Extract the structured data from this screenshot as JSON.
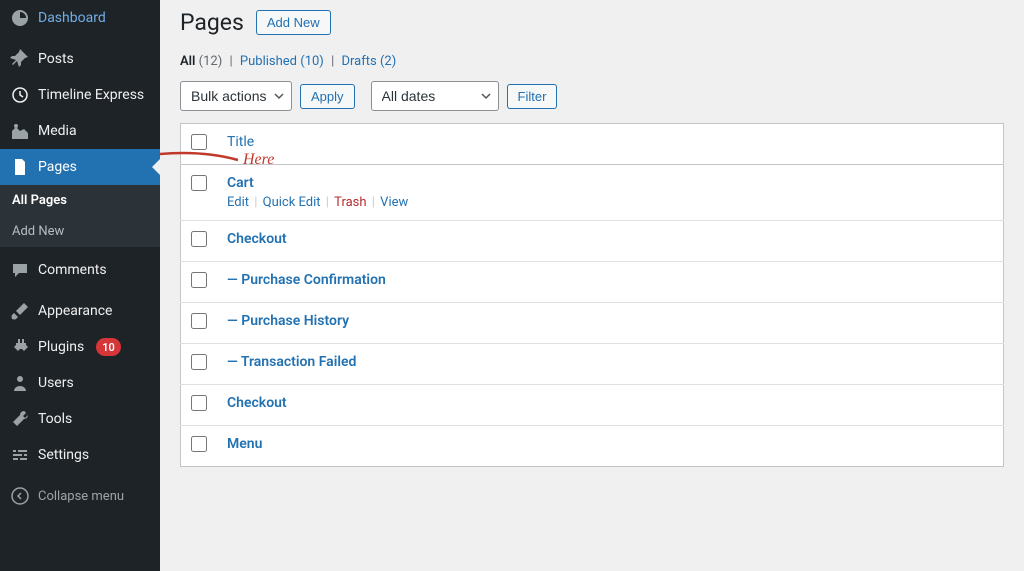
{
  "sidebar": {
    "items": [
      {
        "label": "Dashboard",
        "icon": "dashboard"
      },
      {
        "label": "Posts",
        "icon": "pin"
      },
      {
        "label": "Timeline Express",
        "icon": "clock"
      },
      {
        "label": "Media",
        "icon": "media"
      },
      {
        "label": "Pages",
        "icon": "page",
        "active": true
      },
      {
        "label": "Comments",
        "icon": "comment"
      },
      {
        "label": "Appearance",
        "icon": "brush"
      },
      {
        "label": "Plugins",
        "icon": "plug",
        "badge": "10"
      },
      {
        "label": "Users",
        "icon": "user"
      },
      {
        "label": "Tools",
        "icon": "wrench"
      },
      {
        "label": "Settings",
        "icon": "sliders"
      }
    ],
    "submenu": [
      {
        "label": "All Pages",
        "current": true
      },
      {
        "label": "Add New"
      }
    ],
    "collapse": "Collapse menu"
  },
  "header": {
    "title": "Pages",
    "add_new": "Add New"
  },
  "filters": {
    "all_label": "All",
    "all_count": "(12)",
    "published_label": "Published",
    "published_count": "(10)",
    "drafts_label": "Drafts",
    "drafts_count": "(2)"
  },
  "tablenav": {
    "bulk_actions": "Bulk actions",
    "apply": "Apply",
    "all_dates": "All dates",
    "filter": "Filter"
  },
  "table": {
    "title_col": "Title",
    "rows": [
      {
        "title": "Cart",
        "show_actions": true
      },
      {
        "title": "Checkout"
      },
      {
        "title": "— Purchase Confirmation"
      },
      {
        "title": "— Purchase History"
      },
      {
        "title": "— Transaction Failed"
      },
      {
        "title": "Checkout"
      },
      {
        "title": "Menu"
      }
    ],
    "actions": {
      "edit": "Edit",
      "quick_edit": "Quick Edit",
      "trash": "Trash",
      "view": "View"
    }
  },
  "annotation": {
    "text": "Here"
  }
}
